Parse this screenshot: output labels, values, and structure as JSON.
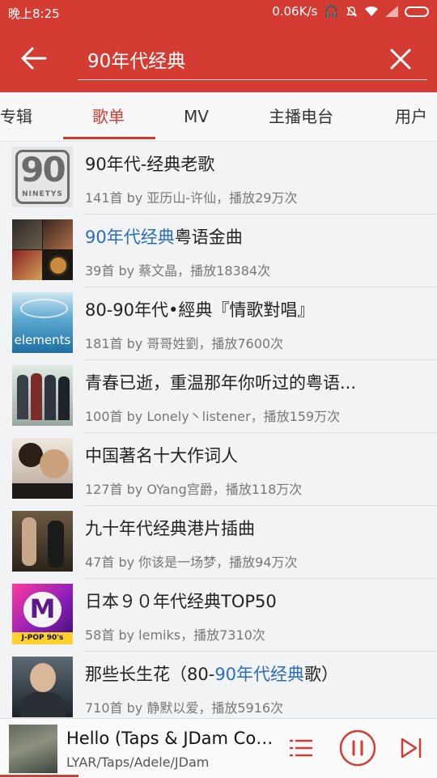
{
  "status_bar": {
    "time": "晚上8:25",
    "speed": "0.06K/s"
  },
  "search": {
    "query": "90年代经典"
  },
  "tabs": [
    {
      "label": "专辑"
    },
    {
      "label": "歌单"
    },
    {
      "label": "MV"
    },
    {
      "label": "主播电台"
    },
    {
      "label": "用户"
    }
  ],
  "active_tab": "歌单",
  "results": [
    {
      "title_pre": "90年代-经典老歌",
      "title_hl": "",
      "title_post": "",
      "meta": "141首  by 亚历山-许仙，播放29万次",
      "cover": "nineties-logo"
    },
    {
      "title_pre": "",
      "title_hl": "90年代经典",
      "title_post": "粤语金曲",
      "meta": "39首  by 蔡文晶，播放18384次",
      "cover": "album-collage"
    },
    {
      "title_pre": "80-90年代•經典『情歌對唱』",
      "title_hl": "",
      "title_post": "",
      "meta": "181首  by 哥哥姓劉，播放7600次",
      "cover": "water-elements"
    },
    {
      "title_pre": "青春已逝，重温那年你听过的粤语...",
      "title_hl": "",
      "title_post": "",
      "meta": "100首  by Lonely丶listener，播放159万次",
      "cover": "band-photo"
    },
    {
      "title_pre": "中国著名十大作词人",
      "title_hl": "",
      "title_post": "",
      "meta": "127首  by OYang宫爵，播放118万次",
      "cover": "portrait-photo"
    },
    {
      "title_pre": "九十年代经典港片插曲",
      "title_hl": "",
      "title_post": "",
      "meta": "47首  by 你该是一场梦，播放94万次",
      "cover": "movie-still"
    },
    {
      "title_pre": "日本９０年代经典TOP50",
      "title_hl": "",
      "title_post": "",
      "meta": "58首  by lemiks，播放7310次",
      "cover": "jpop-logo"
    },
    {
      "title_pre": "那些长生花（80-",
      "title_hl": "90年代经典",
      "title_post": "歌）",
      "meta": "710首  by 静默以爱，播放5916次",
      "cover": "singer-portrait"
    }
  ],
  "cover_labels": {
    "nineties_digits": "90",
    "nineties_word": "NINETYS",
    "jpop": "J-POP 90's",
    "elements": "elements"
  },
  "player": {
    "song": "Hello (Taps & JDam Cov...",
    "artist": "LYAR/Taps/Adele/JDam",
    "progress": 0.18
  },
  "colors": {
    "accent": "#d43c33",
    "highlight": "#2a6ebd"
  }
}
